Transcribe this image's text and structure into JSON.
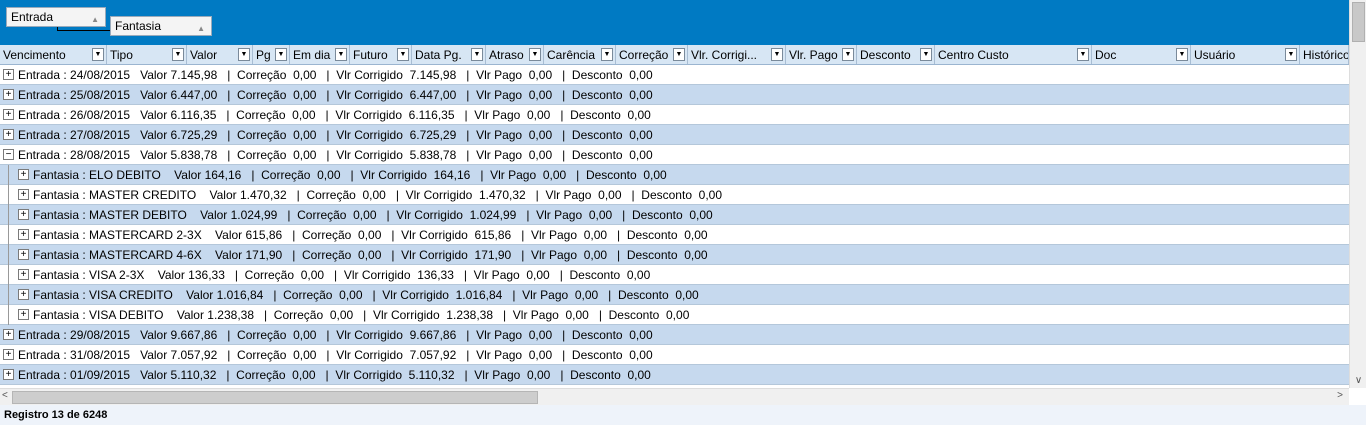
{
  "group_area": {
    "chips": [
      {
        "label": "Entrada"
      },
      {
        "label": "Fantasia"
      }
    ]
  },
  "columns": [
    "Vencimento",
    "Tipo",
    "Valor",
    "Pg",
    "Em dia",
    "Futuro",
    "Data Pg.",
    "Atraso",
    "Carência",
    "Correção",
    "Vlr. Corrigi...",
    "Vlr. Pago",
    "Desconto",
    "Centro Custo",
    "Doc",
    "Usuário",
    "Histórico"
  ],
  "rows": [
    {
      "kind": "group",
      "expanded": false,
      "text": "Entrada : 24/08/2015   Valor 7.145,98   |  Correção  0,00   |  Vlr Corrigido  7.145,98   |  Vlr Pago  0,00   |  Desconto  0,00"
    },
    {
      "kind": "group",
      "expanded": false,
      "text": "Entrada : 25/08/2015   Valor 6.447,00   |  Correção  0,00   |  Vlr Corrigido  6.447,00   |  Vlr Pago  0,00   |  Desconto  0,00"
    },
    {
      "kind": "group",
      "expanded": false,
      "text": "Entrada : 26/08/2015   Valor 6.116,35   |  Correção  0,00   |  Vlr Corrigido  6.116,35   |  Vlr Pago  0,00   |  Desconto  0,00"
    },
    {
      "kind": "group",
      "expanded": false,
      "text": "Entrada : 27/08/2015   Valor 6.725,29   |  Correção  0,00   |  Vlr Corrigido  6.725,29   |  Vlr Pago  0,00   |  Desconto  0,00"
    },
    {
      "kind": "group",
      "expanded": true,
      "text": "Entrada : 28/08/2015   Valor 5.838,78   |  Correção  0,00   |  Vlr Corrigido  5.838,78   |  Vlr Pago  0,00   |  Desconto  0,00"
    },
    {
      "kind": "child",
      "expanded": false,
      "text": "Fantasia : ELO DEBITO    Valor 164,16   |  Correção  0,00   |  Vlr Corrigido  164,16   |  Vlr Pago  0,00   |  Desconto  0,00"
    },
    {
      "kind": "child",
      "expanded": false,
      "text": "Fantasia : MASTER CREDITO    Valor 1.470,32   |  Correção  0,00   |  Vlr Corrigido  1.470,32   |  Vlr Pago  0,00   |  Desconto  0,00"
    },
    {
      "kind": "child",
      "expanded": false,
      "text": "Fantasia : MASTER DEBITO    Valor 1.024,99   |  Correção  0,00   |  Vlr Corrigido  1.024,99   |  Vlr Pago  0,00   |  Desconto  0,00"
    },
    {
      "kind": "child",
      "expanded": false,
      "text": "Fantasia : MASTERCARD 2-3X    Valor 615,86   |  Correção  0,00   |  Vlr Corrigido  615,86   |  Vlr Pago  0,00   |  Desconto  0,00"
    },
    {
      "kind": "child",
      "expanded": false,
      "text": "Fantasia : MASTERCARD 4-6X    Valor 171,90   |  Correção  0,00   |  Vlr Corrigido  171,90   |  Vlr Pago  0,00   |  Desconto  0,00"
    },
    {
      "kind": "child",
      "expanded": false,
      "text": "Fantasia : VISA 2-3X    Valor 136,33   |  Correção  0,00   |  Vlr Corrigido  136,33   |  Vlr Pago  0,00   |  Desconto  0,00"
    },
    {
      "kind": "child",
      "expanded": false,
      "text": "Fantasia : VISA CREDITO    Valor 1.016,84   |  Correção  0,00   |  Vlr Corrigido  1.016,84   |  Vlr Pago  0,00   |  Desconto  0,00"
    },
    {
      "kind": "child",
      "expanded": false,
      "text": "Fantasia : VISA DEBITO    Valor 1.238,38   |  Correção  0,00   |  Vlr Corrigido  1.238,38   |  Vlr Pago  0,00   |  Desconto  0,00"
    },
    {
      "kind": "group",
      "expanded": false,
      "text": "Entrada : 29/08/2015   Valor 9.667,86   |  Correção  0,00   |  Vlr Corrigido  9.667,86   |  Vlr Pago  0,00   |  Desconto  0,00"
    },
    {
      "kind": "group",
      "expanded": false,
      "text": "Entrada : 31/08/2015   Valor 7.057,92   |  Correção  0,00   |  Vlr Corrigido  7.057,92   |  Vlr Pago  0,00   |  Desconto  0,00"
    },
    {
      "kind": "group",
      "expanded": false,
      "text": "Entrada : 01/09/2015   Valor 5.110,32   |  Correção  0,00   |  Vlr Corrigido  5.110,32   |  Vlr Pago  0,00   |  Desconto  0,00"
    }
  ],
  "status_bar": {
    "text": "Registro 13 de 6248"
  },
  "icons": {
    "expand": "plus-box-icon",
    "collapse": "minus-box-icon",
    "dropdown": "dropdown-arrow-icon",
    "sort": "sort-arrow-icon"
  },
  "colors": {
    "group_panel": "#007ac3",
    "header": "#d7e6f4",
    "alt_row": "#c6d9ee"
  }
}
